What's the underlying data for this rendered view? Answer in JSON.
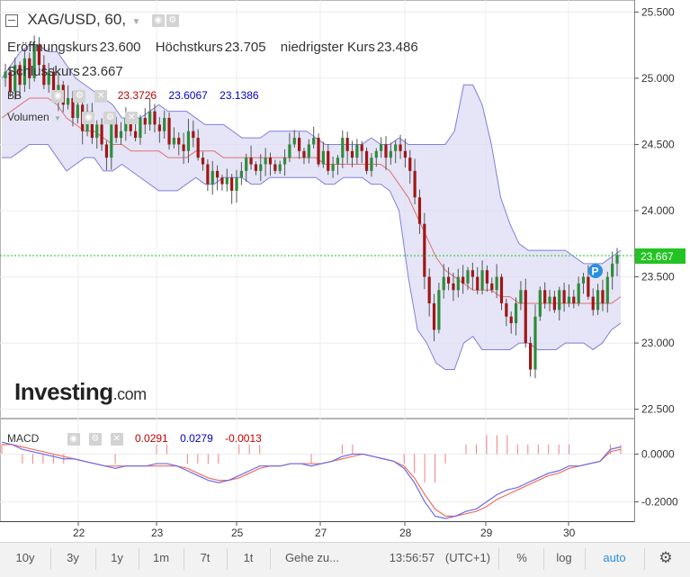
{
  "header": {
    "symbol": "XAG/USD, 60,",
    "open_label": "Eröffnungskurs",
    "open_value": "23.600",
    "high_label": "Höchstkurs",
    "high_value": "23.705",
    "low_label": "niedrigster Kurs",
    "low_value": "23.486",
    "close_label": "Schlusskurs",
    "close_value": "23.667"
  },
  "indicators": {
    "bb_label": "BB",
    "bb_lower": "23.3726",
    "bb_middle": "23.6067",
    "bb_upper": "23.1386",
    "volume_label": "Volumen",
    "macd_label": "MACD",
    "macd_value": "0.0291",
    "macd_signal": "0.0279",
    "macd_hist": "-0.0013"
  },
  "watermark": {
    "brand": "Investing",
    "suffix": ".com"
  },
  "price_tag": "23.667",
  "colors": {
    "up": "#2e8b3a",
    "down": "#a01616",
    "band": "#7f7fdc",
    "band_fill": "#dcdcf4",
    "ma": "#e07070",
    "macd_line": "#6a6aea",
    "signal_line": "#f07060",
    "price_tag": "#22c322"
  },
  "chart_data": {
    "type": "candlestick",
    "y_axis": {
      "range": [
        22.45,
        25.55
      ],
      "ticks": [
        "25.500",
        "25.000",
        "24.500",
        "24.000",
        "23.500",
        "23.000",
        "22.500"
      ]
    },
    "x_axis": {
      "labels": [
        "22",
        "23",
        "25",
        "27",
        "28",
        "29",
        "30"
      ]
    },
    "macd_axis": {
      "range": [
        -0.27,
        0.13
      ],
      "ticks": [
        "0.0000",
        "-0.2000"
      ]
    },
    "closes": [
      25.05,
      24.9,
      25.1,
      24.95,
      25.15,
      25.0,
      25.25,
      25.1,
      24.95,
      25.05,
      24.85,
      24.95,
      24.8,
      24.85,
      24.7,
      24.8,
      24.6,
      24.75,
      24.55,
      24.65,
      24.5,
      24.4,
      24.65,
      24.55,
      24.6,
      24.7,
      24.6,
      24.55,
      24.7,
      24.65,
      24.75,
      24.65,
      24.6,
      24.7,
      24.5,
      24.55,
      24.5,
      24.45,
      24.6,
      24.55,
      24.4,
      24.35,
      24.2,
      24.3,
      24.25,
      24.2,
      24.25,
      24.15,
      24.25,
      24.3,
      24.4,
      24.35,
      24.3,
      24.35,
      24.4,
      24.35,
      24.3,
      24.35,
      24.4,
      24.5,
      24.55,
      24.45,
      24.4,
      24.5,
      24.55,
      24.35,
      24.45,
      24.3,
      24.35,
      24.4,
      24.55,
      24.45,
      24.4,
      24.5,
      24.45,
      24.3,
      24.4,
      24.45,
      24.5,
      24.4,
      24.45,
      24.5,
      24.45,
      24.4,
      24.3,
      24.1,
      23.9,
      23.5,
      23.3,
      23.1,
      23.4,
      23.5,
      23.45,
      23.4,
      23.5,
      23.45,
      23.55,
      23.5,
      23.4,
      23.55,
      23.45,
      23.4,
      23.5,
      23.3,
      23.2,
      23.15,
      23.3,
      23.4,
      23.0,
      22.8,
      23.2,
      23.4,
      23.3,
      23.35,
      23.25,
      23.4,
      23.3,
      23.35,
      23.3,
      23.45,
      23.5,
      23.35,
      23.25,
      23.4,
      23.3,
      23.5,
      23.6,
      23.667
    ],
    "bb_upper": [
      25.0,
      25.1,
      25.2,
      25.25,
      25.25,
      25.2,
      25.2,
      25.1,
      25.0,
      24.95,
      24.9,
      24.85,
      24.8,
      24.7,
      24.7,
      24.7,
      24.75,
      24.8,
      24.75,
      24.75,
      24.75,
      24.7,
      24.65,
      24.65,
      24.65,
      24.6,
      24.55,
      24.55,
      24.55,
      24.6,
      24.6,
      24.6,
      24.6,
      24.6,
      24.55,
      24.5,
      24.5,
      24.5,
      24.5,
      24.5,
      24.55,
      24.5,
      24.5,
      24.55,
      24.5,
      24.5,
      24.5,
      24.5,
      24.5,
      24.6,
      24.95,
      24.95,
      24.8,
      24.5,
      24.1,
      23.9,
      23.75,
      23.7,
      23.7,
      23.7,
      23.7,
      23.7,
      23.65,
      23.6,
      23.6,
      23.6,
      23.65,
      23.7
    ],
    "bb_lower": [
      24.4,
      24.4,
      24.45,
      24.5,
      24.5,
      24.5,
      24.4,
      24.3,
      24.35,
      24.4,
      24.4,
      24.3,
      24.3,
      24.35,
      24.3,
      24.25,
      24.2,
      24.15,
      24.15,
      24.15,
      24.2,
      24.25,
      24.2,
      24.2,
      24.25,
      24.25,
      24.25,
      24.2,
      24.2,
      24.25,
      24.25,
      24.25,
      24.25,
      24.25,
      24.25,
      24.2,
      24.2,
      24.25,
      24.25,
      24.25,
      24.2,
      24.2,
      24.15,
      24.0,
      23.5,
      23.1,
      23.0,
      22.85,
      22.8,
      22.8,
      23.0,
      23.05,
      22.95,
      22.95,
      22.95,
      22.95,
      23.0,
      23.0,
      22.95,
      22.95,
      22.95,
      23.0,
      23.0,
      23.0,
      22.95,
      23.0,
      23.1,
      23.15
    ],
    "ma": [
      24.7,
      24.75,
      24.8,
      24.85,
      24.85,
      24.85,
      24.8,
      24.7,
      24.65,
      24.6,
      24.6,
      24.55,
      24.5,
      24.5,
      24.45,
      24.45,
      24.45,
      24.45,
      24.4,
      24.4,
      24.4,
      24.45,
      24.45,
      24.45,
      24.4,
      24.4,
      24.4,
      24.4,
      24.4,
      24.4,
      24.4,
      24.4,
      24.4,
      24.4,
      24.4,
      24.35,
      24.35,
      24.35,
      24.35,
      24.35,
      24.35,
      24.35,
      24.3,
      24.2,
      24.1,
      23.95,
      23.8,
      23.65,
      23.55,
      23.5,
      23.45,
      23.4,
      23.4,
      23.4,
      23.35,
      23.35,
      23.3,
      23.3,
      23.3,
      23.3,
      23.3,
      23.3,
      23.3,
      23.3,
      23.3,
      23.3,
      23.3,
      23.35
    ],
    "macd": [
      0.05,
      0.04,
      0.02,
      0.01,
      0.0,
      -0.01,
      -0.02,
      -0.02,
      -0.03,
      -0.04,
      -0.05,
      -0.06,
      -0.05,
      -0.05,
      -0.05,
      -0.04,
      -0.04,
      -0.05,
      -0.07,
      -0.09,
      -0.11,
      -0.12,
      -0.11,
      -0.09,
      -0.07,
      -0.05,
      -0.05,
      -0.05,
      -0.04,
      -0.04,
      -0.05,
      -0.04,
      -0.03,
      -0.01,
      0.0,
      0.0,
      -0.01,
      -0.02,
      -0.03,
      -0.06,
      -0.12,
      -0.2,
      -0.26,
      -0.27,
      -0.26,
      -0.24,
      -0.23,
      -0.2,
      -0.17,
      -0.15,
      -0.14,
      -0.12,
      -0.1,
      -0.08,
      -0.07,
      -0.05,
      -0.05,
      -0.04,
      -0.03,
      0.02,
      0.03
    ],
    "signal": [
      0.04,
      0.04,
      0.03,
      0.02,
      0.01,
      0.0,
      -0.01,
      -0.02,
      -0.03,
      -0.04,
      -0.05,
      -0.05,
      -0.05,
      -0.05,
      -0.05,
      -0.05,
      -0.05,
      -0.05,
      -0.06,
      -0.08,
      -0.1,
      -0.11,
      -0.11,
      -0.1,
      -0.08,
      -0.06,
      -0.05,
      -0.05,
      -0.04,
      -0.04,
      -0.04,
      -0.04,
      -0.03,
      -0.02,
      -0.01,
      0.0,
      -0.01,
      -0.02,
      -0.03,
      -0.05,
      -0.1,
      -0.17,
      -0.23,
      -0.26,
      -0.26,
      -0.25,
      -0.24,
      -0.22,
      -0.19,
      -0.17,
      -0.15,
      -0.13,
      -0.11,
      -0.09,
      -0.08,
      -0.06,
      -0.05,
      -0.04,
      -0.03,
      0.01,
      0.02
    ]
  },
  "bottom_bar": {
    "ranges": [
      "10y",
      "3y",
      "1y",
      "1m",
      "7t",
      "1t"
    ],
    "goto": "Gehe zu...",
    "time": "13:56:57",
    "tz": "(UTC+1)",
    "percent": "%",
    "log": "log",
    "auto": "auto"
  }
}
